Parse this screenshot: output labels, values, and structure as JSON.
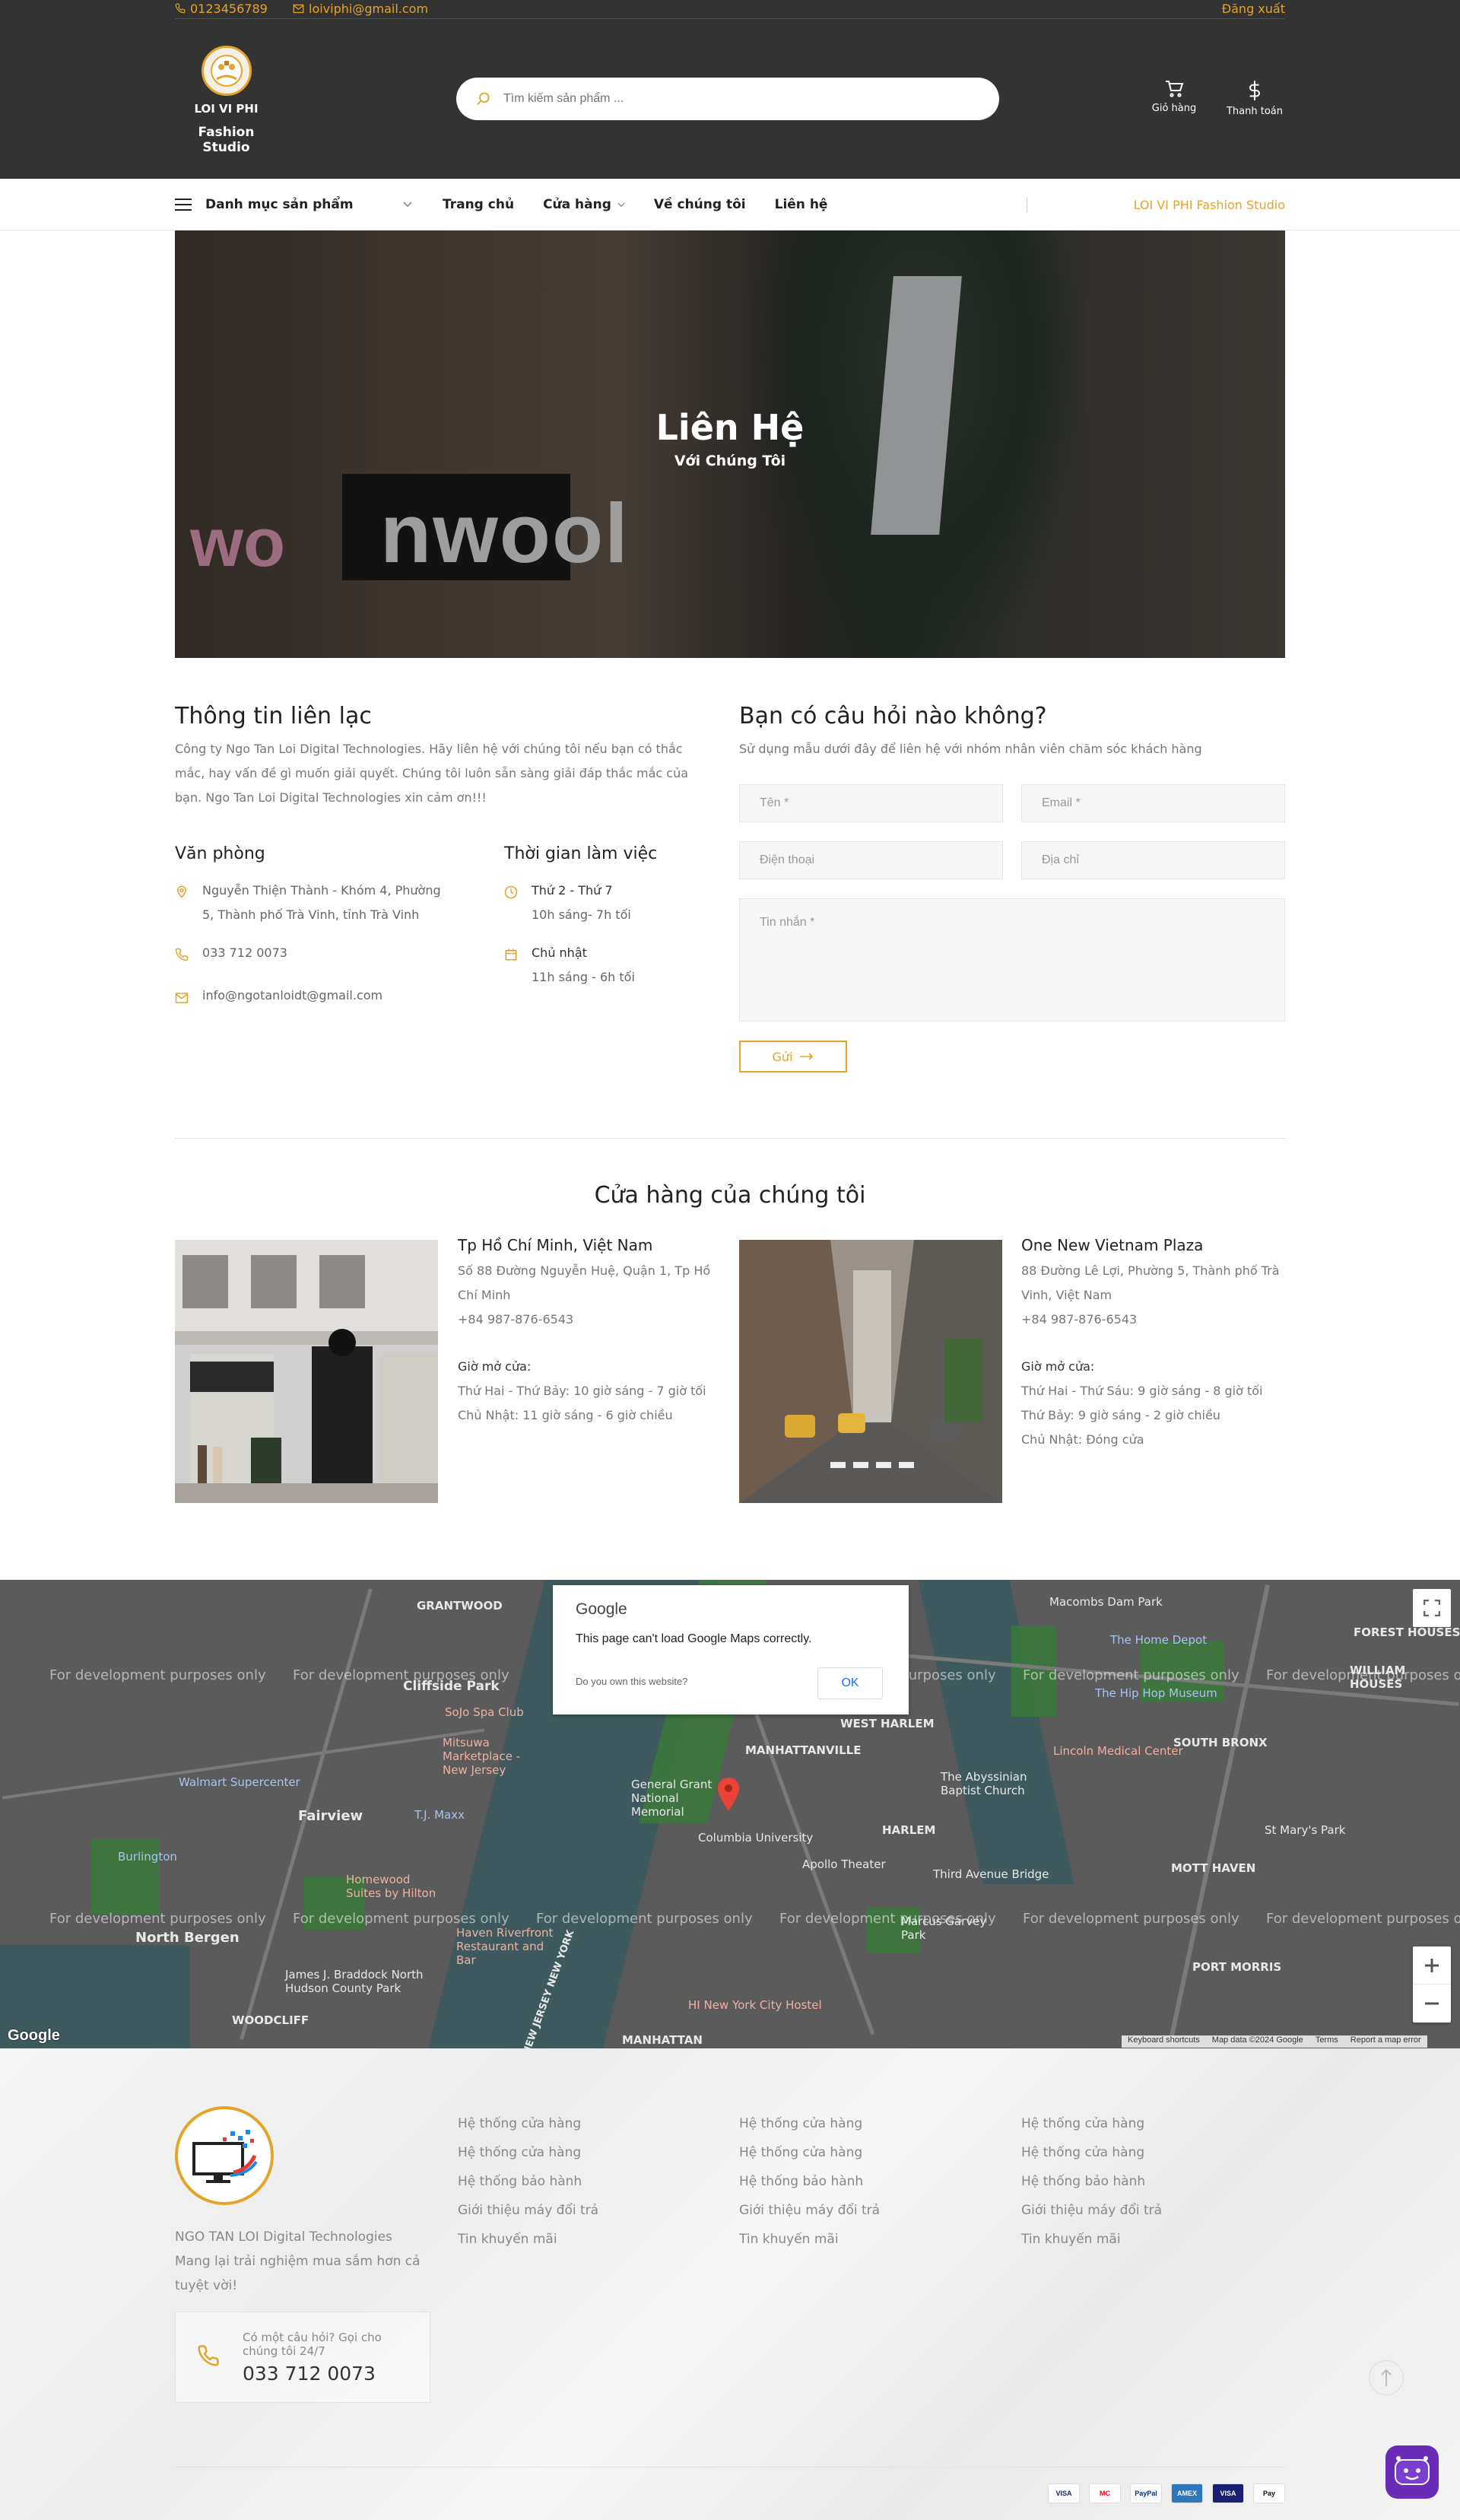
{
  "topbar": {
    "phone": "0123456789",
    "email": "loiviphi@gmail.com",
    "logout": "Đăng xuất"
  },
  "header": {
    "logo_line1": "LOI VI PHI",
    "logo_line2": "Fashion Studio",
    "search_placeholder": "Tìm kiếm sản phẩm ...",
    "cart_label": "Giỏ hàng",
    "checkout_label": "Thanh toán"
  },
  "nav": {
    "category_label": "Danh mục sản phẩm",
    "items": [
      "Trang chủ",
      "Cửa hàng",
      "Về chúng tôi",
      "Liên hệ"
    ],
    "brand_right": "LOI VI PHI Fashion Studio"
  },
  "hero": {
    "title": "Liên Hệ",
    "subtitle": "Với Chúng Tôi",
    "sign_text": "nwool",
    "sign_pink": "wo"
  },
  "contact_info": {
    "title": "Thông tin liên lạc",
    "description": "Công ty Ngo Tan Loi Digital Technologies. Hãy liên hệ với chúng tôi nếu bạn có thắc mắc, hay vấn đề gì muốn giải quyết. Chúng tôi luôn sẵn sàng giải đáp thắc mắc của bạn. Ngo Tan Loi Digital Technologies xin cảm ơn!!!",
    "office_title": "Văn phòng",
    "address": "Nguyễn Thiện Thành - Khóm 4, Phường 5, Thành phố Trà Vinh, tỉnh Trà Vinh",
    "phone": "033 712 0073",
    "email": "info@ngotanloidt@gmail.com",
    "hours_title": "Thời gian làm việc",
    "weekday_label": "Thứ 2 - Thứ 7",
    "weekday_hours": "10h sáng- 7h tối",
    "sunday_label": "Chủ nhật",
    "sunday_hours": "11h sáng - 6h tối"
  },
  "contact_form": {
    "title": "Bạn có câu hỏi nào không?",
    "description": "Sử dụng mẫu dưới đây để liên hệ với nhóm nhân viên chăm sóc khách hàng",
    "name_placeholder": "Tên *",
    "email_placeholder": "Email *",
    "phone_placeholder": "Điện thoại",
    "address_placeholder": "Địa chỉ",
    "message_placeholder": "Tin nhắn *",
    "send_label": "Gửi"
  },
  "stores": {
    "title": "Cửa hàng của chúng tôi",
    "items": [
      {
        "name": "Tp Hồ Chí Minh, Việt Nam",
        "address": "Số 88 Đường Nguyễn Huệ, Quận 1, Tp Hồ Chí Minh",
        "phone": "+84 987-876-6543",
        "hours_title": "Giờ mở cửa:",
        "hours": [
          "Thứ Hai - Thứ Bảy: 10 giờ sáng - 7 giờ tối",
          "Chủ Nhật: 11 giờ sáng - 6 giờ chiều"
        ]
      },
      {
        "name": "One New Vietnam Plaza",
        "address": "88 Đường Lê Lợi, Phường 5, Thành phố Trà Vinh, Việt Nam",
        "phone": "+84 987-876-6543",
        "hours_title": "Giờ mở cửa:",
        "hours": [
          "Thứ Hai - Thứ Sáu: 9 giờ sáng - 8 giờ tối",
          "Thứ Bảy: 9 giờ sáng - 2 giờ chiều",
          "Chủ Nhật: Đóng cửa"
        ]
      }
    ]
  },
  "map": {
    "dialog_brand": "Google",
    "dialog_message": "This page can't load Google Maps correctly.",
    "dialog_link": "Do you own this website?",
    "dialog_ok": "OK",
    "watermark": "For development purposes only",
    "attribution": [
      "Keyboard shortcuts",
      "Map data ©2024 Google",
      "Terms",
      "Report a map error"
    ],
    "logo": "Google",
    "labels": [
      "GRANTWOOD",
      "Cliffside Park",
      "SoJo Spa Club",
      "Mitsuwa Marketplace - New Jersey",
      "Walmart Supercenter",
      "Fairview",
      "T.J. Maxx",
      "Burlington",
      "Homewood Suites by Hilton",
      "North Bergen",
      "James J. Braddock North Hudson County Park",
      "WOODCLIFF",
      "MANHATTANVILLE",
      "General Grant National Memorial",
      "Columbia University",
      "HARLEM",
      "The Abyssinian Baptist Church",
      "Apollo Theater",
      "Third Avenue Bridge",
      "Marcus Garvey Park",
      "MANHATTAN",
      "HI New York City Hostel",
      "The Home Depot",
      "The Hip Hop Museum",
      "Lincoln Medical Center",
      "SOUTH BRONX",
      "MOTT HAVEN",
      "St Mary's Park",
      "PORT MORRIS",
      "WEST HARLEM",
      "Macombs Dam Park",
      "FOREST HOUSES",
      "WILLIAM HOUSES",
      "Haven Riverfront Restaurant and Bar",
      "NEW JERSEY NEW YORK"
    ]
  },
  "footer": {
    "company": "NGO TAN LOI Digital Technologies",
    "tagline": "Mang lại trải nghiệm mua sắm hơn cả tuyệt vời!",
    "help_text": "Có một câu hỏi? Gọi cho chúng tôi 24/7",
    "help_phone": "033 712 0073",
    "columns": [
      [
        "Hệ thống cửa hàng",
        "Hệ thống cửa hàng",
        "Hệ thống bảo hành",
        "Giới thiệu máy đổi trả",
        "Tin khuyến mãi"
      ],
      [
        "Hệ thống cửa hàng",
        "Hệ thống cửa hàng",
        "Hệ thống bảo hành",
        "Giới thiệu máy đổi trả",
        "Tin khuyến mãi"
      ],
      [
        "Hệ thống cửa hàng",
        "Hệ thống cửa hàng",
        "Hệ thống bảo hành",
        "Giới thiệu máy đổi trả",
        "Tin khuyến mãi"
      ]
    ],
    "payments": [
      "VISA",
      "MC",
      "PayPal",
      "AMEX",
      "VISA",
      "Pay"
    ]
  },
  "colors": {
    "accent": "#e5a32a",
    "header_bg": "#333333",
    "map_bg": "#5b5b5b"
  }
}
